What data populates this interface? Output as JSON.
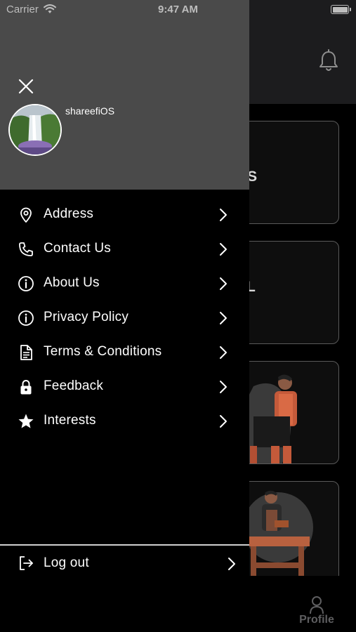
{
  "status_bar": {
    "carrier": "Carrier",
    "time": "9:47 AM"
  },
  "background": {
    "cards": [
      {
        "visible_text": "CES"
      },
      {
        "visible_text": "L"
      },
      {
        "visible_text": ""
      },
      {
        "visible_text": ""
      }
    ],
    "tab_bar": {
      "profile_label": "Profile"
    }
  },
  "drawer": {
    "username": "shareefiOS",
    "menu": [
      {
        "label": "Address",
        "icon": "location-pin-icon"
      },
      {
        "label": "Contact Us",
        "icon": "phone-icon"
      },
      {
        "label": "About Us",
        "icon": "info-icon"
      },
      {
        "label": "Privacy Policy",
        "icon": "info-icon"
      },
      {
        "label": "Terms & Conditions",
        "icon": "document-icon"
      },
      {
        "label": "Feedback",
        "icon": "lock-icon"
      },
      {
        "label": "Interests",
        "icon": "star-icon"
      }
    ],
    "logout": {
      "label": "Log out",
      "icon": "logout-icon"
    }
  },
  "colors": {
    "drawer_header": "#4a4a4a",
    "drawer_bg": "#000000",
    "text": "#ffffff"
  }
}
